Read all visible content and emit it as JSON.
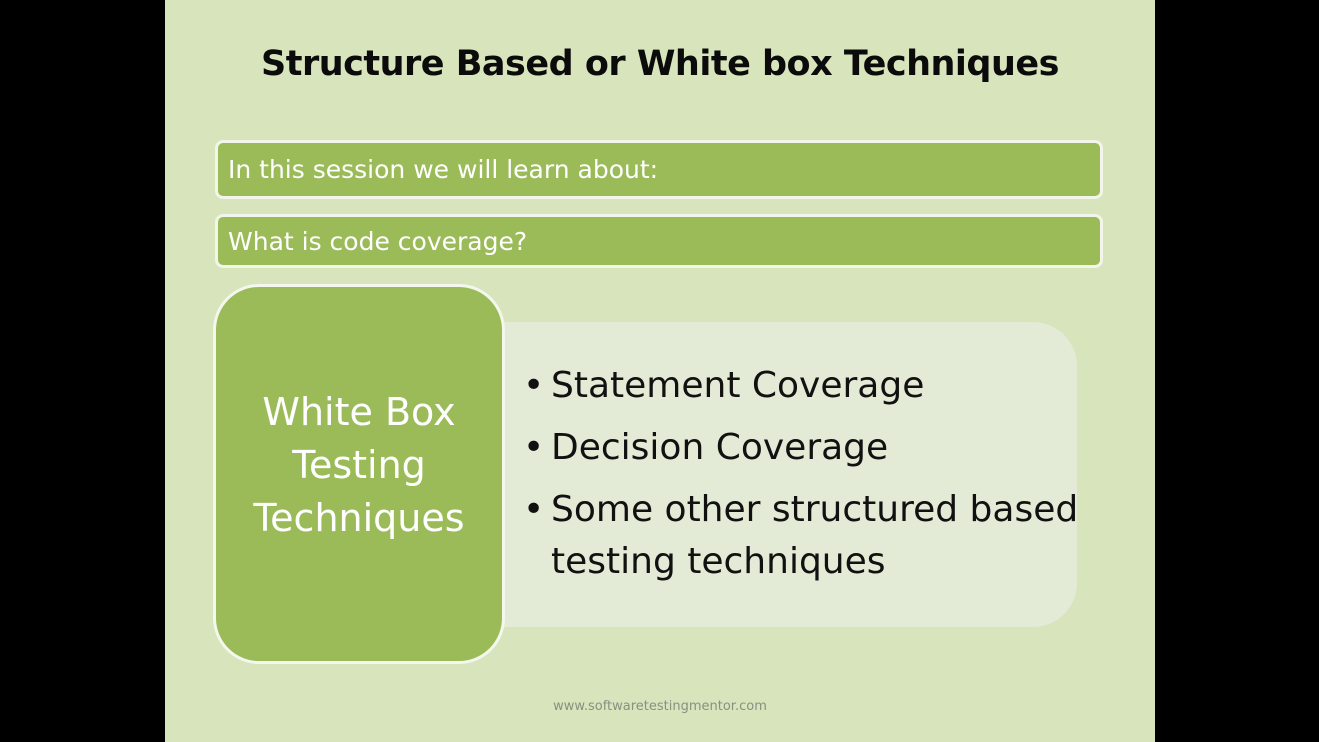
{
  "slide": {
    "title": "Structure Based or White box Techniques",
    "bars": [
      {
        "label": "In this session we will learn about:"
      },
      {
        "label": "What is code coverage?"
      }
    ],
    "feature_box": {
      "text": "White Box Testing Techniques"
    },
    "bullets": [
      {
        "marker": "•",
        "text": "Statement Coverage"
      },
      {
        "marker": "•",
        "text": "Decision Coverage"
      },
      {
        "marker": "•",
        "text": "Some other structured based testing techniques"
      }
    ],
    "footer_url": "www.softwaretestingmentor.com"
  },
  "colors": {
    "letterbox": "#000000",
    "slide_background": "#d8e4bc",
    "accent_green": "#9bbb59",
    "bullet_panel": "#e3ead5",
    "title_text": "#0b0b0b"
  }
}
